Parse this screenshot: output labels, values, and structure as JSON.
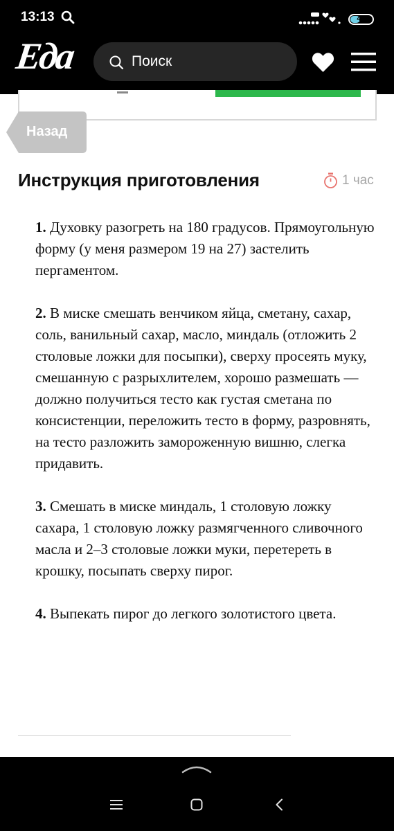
{
  "status_bar": {
    "time": "13:13",
    "battery": "49",
    "battery_level": 0.49
  },
  "header": {
    "logo": "Еда",
    "search_placeholder": "Поиск"
  },
  "navigation": {
    "back_label": "Назад"
  },
  "instructions": {
    "title": "Инструкция приготовления",
    "time": "1 час",
    "steps": [
      {
        "number": "1.",
        "text": "Духовку разогреть на 180 градусов. Прямоугольную форму (у меня размером 19 на 27) застелить пергаментом."
      },
      {
        "number": "2.",
        "text": "В миске смешать венчиком яйца, сметану, сахар, соль, ванильный сахар, масло, миндаль (отложить 2 столовые ложки для посыпки), сверху просеять муку, смешанную с разрыхлителем, хорошо размешать — должно получиться тесто как густая сметана по консистенции, переложить тесто в форму, разровнять, на тесто разложить замороженную вишню, слегка придавить."
      },
      {
        "number": "3.",
        "text": "Смешать в миске миндаль, 1 столовую ложку сахара, 1 столовую ложку размягченного сливочного масла и 2–3 столовые ложки муки, перетереть в крошку, посыпать сверху пирог."
      },
      {
        "number": "4.",
        "text": "Выпекать пирог до легкого золотистого цвета."
      }
    ]
  },
  "colors": {
    "header_bg": "#000000",
    "search_bg": "#262626",
    "accent_green": "#2db84c",
    "back_tag": "#c4c4c4",
    "timer_red": "#e8736e",
    "muted_text": "#a6a6a6"
  }
}
